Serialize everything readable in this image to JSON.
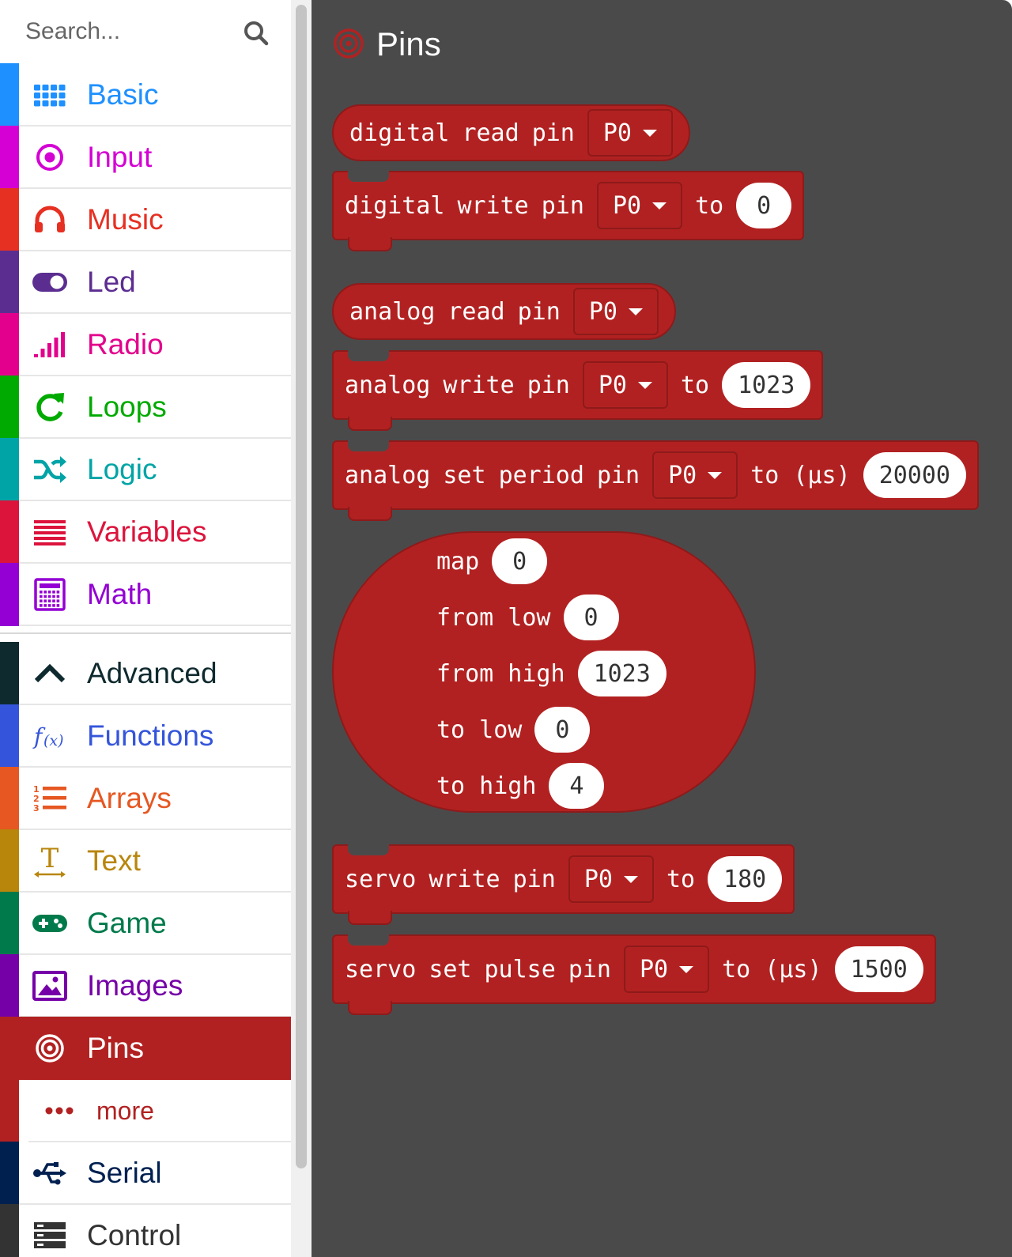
{
  "search": {
    "placeholder": "Search..."
  },
  "categories": [
    {
      "label": "Basic",
      "color": "#1e90ff",
      "icon": "grid-icon"
    },
    {
      "label": "Input",
      "color": "#d400d4",
      "icon": "radio-button-icon"
    },
    {
      "label": "Music",
      "color": "#e63022",
      "icon": "headphones-icon"
    },
    {
      "label": "Led",
      "color": "#5c2d91",
      "icon": "toggle-icon"
    },
    {
      "label": "Radio",
      "color": "#e3008c",
      "icon": "signal-bars-icon"
    },
    {
      "label": "Loops",
      "color": "#00aa00",
      "icon": "refresh-icon"
    },
    {
      "label": "Logic",
      "color": "#00a4a6",
      "icon": "shuffle-icon"
    },
    {
      "label": "Variables",
      "color": "#dc143c",
      "icon": "lines-icon"
    },
    {
      "label": "Math",
      "color": "#9400d3",
      "icon": "calculator-icon"
    }
  ],
  "advanced": [
    {
      "label": "Advanced",
      "color": "#0f2a2f",
      "icon": "chevron-up-icon"
    },
    {
      "label": "Functions",
      "color": "#3455db",
      "icon": "function-icon"
    },
    {
      "label": "Arrays",
      "color": "#e65722",
      "icon": "numbered-list-icon"
    },
    {
      "label": "Text",
      "color": "#b8860b",
      "icon": "text-icon"
    },
    {
      "label": "Game",
      "color": "#007a4b",
      "icon": "gamepad-icon"
    },
    {
      "label": "Images",
      "color": "#7600a8",
      "icon": "image-icon"
    },
    {
      "label": "Pins",
      "color": "#b22121",
      "icon": "target-icon"
    },
    {
      "label": "more",
      "color": "#b22121",
      "icon": "dots-icon"
    },
    {
      "label": "Serial",
      "color": "#002050",
      "icon": "usb-icon"
    },
    {
      "label": "Control",
      "color": "#333333",
      "icon": "server-icon"
    }
  ],
  "flyout": {
    "title": "Pins",
    "blocks": [
      {
        "words": [
          "digital",
          "read",
          "pin"
        ],
        "pin": "P0"
      },
      {
        "words": [
          "digital",
          "write",
          "pin"
        ],
        "pin": "P0",
        "to": "to",
        "value": "0"
      },
      {
        "words": [
          "analog",
          "read",
          "pin"
        ],
        "pin": "P0"
      },
      {
        "words": [
          "analog",
          "write",
          "pin"
        ],
        "pin": "P0",
        "to": "to",
        "value": "1023"
      },
      {
        "words": [
          "analog",
          "set",
          "period",
          "pin"
        ],
        "pin": "P0",
        "to": "to (µs)",
        "value": "20000"
      },
      {
        "words": [
          "servo",
          "write",
          "pin"
        ],
        "pin": "P0",
        "to": "to",
        "value": "180"
      },
      {
        "words": [
          "servo",
          "set",
          "pulse",
          "pin"
        ],
        "pin": "P0",
        "to": "to (µs)",
        "value": "1500"
      }
    ],
    "map": {
      "rows": [
        {
          "label": "map",
          "value": "0"
        },
        {
          "label": "from low",
          "value": "0"
        },
        {
          "label": "from high",
          "value": "1023"
        },
        {
          "label": "to low",
          "value": "0"
        },
        {
          "label": "to high",
          "value": "4"
        }
      ]
    }
  }
}
